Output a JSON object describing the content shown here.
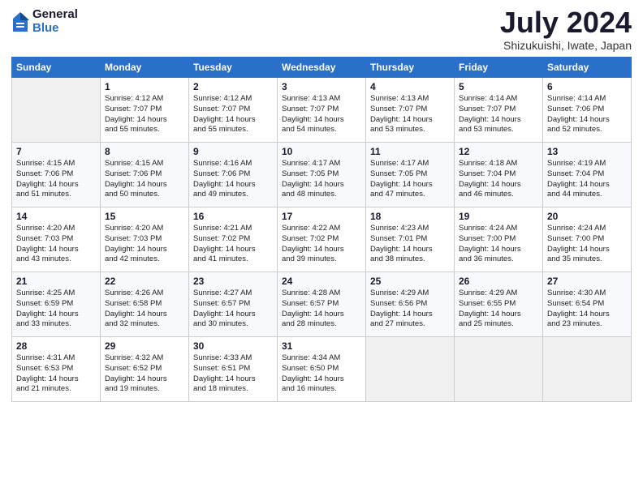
{
  "logo": {
    "general": "General",
    "blue": "Blue"
  },
  "title": "July 2024",
  "location": "Shizukuishi, Iwate, Japan",
  "headers": [
    "Sunday",
    "Monday",
    "Tuesday",
    "Wednesday",
    "Thursday",
    "Friday",
    "Saturday"
  ],
  "weeks": [
    [
      {
        "day": "",
        "info": ""
      },
      {
        "day": "1",
        "info": "Sunrise: 4:12 AM\nSunset: 7:07 PM\nDaylight: 14 hours\nand 55 minutes."
      },
      {
        "day": "2",
        "info": "Sunrise: 4:12 AM\nSunset: 7:07 PM\nDaylight: 14 hours\nand 55 minutes."
      },
      {
        "day": "3",
        "info": "Sunrise: 4:13 AM\nSunset: 7:07 PM\nDaylight: 14 hours\nand 54 minutes."
      },
      {
        "day": "4",
        "info": "Sunrise: 4:13 AM\nSunset: 7:07 PM\nDaylight: 14 hours\nand 53 minutes."
      },
      {
        "day": "5",
        "info": "Sunrise: 4:14 AM\nSunset: 7:07 PM\nDaylight: 14 hours\nand 53 minutes."
      },
      {
        "day": "6",
        "info": "Sunrise: 4:14 AM\nSunset: 7:06 PM\nDaylight: 14 hours\nand 52 minutes."
      }
    ],
    [
      {
        "day": "7",
        "info": "Sunrise: 4:15 AM\nSunset: 7:06 PM\nDaylight: 14 hours\nand 51 minutes."
      },
      {
        "day": "8",
        "info": "Sunrise: 4:15 AM\nSunset: 7:06 PM\nDaylight: 14 hours\nand 50 minutes."
      },
      {
        "day": "9",
        "info": "Sunrise: 4:16 AM\nSunset: 7:06 PM\nDaylight: 14 hours\nand 49 minutes."
      },
      {
        "day": "10",
        "info": "Sunrise: 4:17 AM\nSunset: 7:05 PM\nDaylight: 14 hours\nand 48 minutes."
      },
      {
        "day": "11",
        "info": "Sunrise: 4:17 AM\nSunset: 7:05 PM\nDaylight: 14 hours\nand 47 minutes."
      },
      {
        "day": "12",
        "info": "Sunrise: 4:18 AM\nSunset: 7:04 PM\nDaylight: 14 hours\nand 46 minutes."
      },
      {
        "day": "13",
        "info": "Sunrise: 4:19 AM\nSunset: 7:04 PM\nDaylight: 14 hours\nand 44 minutes."
      }
    ],
    [
      {
        "day": "14",
        "info": "Sunrise: 4:20 AM\nSunset: 7:03 PM\nDaylight: 14 hours\nand 43 minutes."
      },
      {
        "day": "15",
        "info": "Sunrise: 4:20 AM\nSunset: 7:03 PM\nDaylight: 14 hours\nand 42 minutes."
      },
      {
        "day": "16",
        "info": "Sunrise: 4:21 AM\nSunset: 7:02 PM\nDaylight: 14 hours\nand 41 minutes."
      },
      {
        "day": "17",
        "info": "Sunrise: 4:22 AM\nSunset: 7:02 PM\nDaylight: 14 hours\nand 39 minutes."
      },
      {
        "day": "18",
        "info": "Sunrise: 4:23 AM\nSunset: 7:01 PM\nDaylight: 14 hours\nand 38 minutes."
      },
      {
        "day": "19",
        "info": "Sunrise: 4:24 AM\nSunset: 7:00 PM\nDaylight: 14 hours\nand 36 minutes."
      },
      {
        "day": "20",
        "info": "Sunrise: 4:24 AM\nSunset: 7:00 PM\nDaylight: 14 hours\nand 35 minutes."
      }
    ],
    [
      {
        "day": "21",
        "info": "Sunrise: 4:25 AM\nSunset: 6:59 PM\nDaylight: 14 hours\nand 33 minutes."
      },
      {
        "day": "22",
        "info": "Sunrise: 4:26 AM\nSunset: 6:58 PM\nDaylight: 14 hours\nand 32 minutes."
      },
      {
        "day": "23",
        "info": "Sunrise: 4:27 AM\nSunset: 6:57 PM\nDaylight: 14 hours\nand 30 minutes."
      },
      {
        "day": "24",
        "info": "Sunrise: 4:28 AM\nSunset: 6:57 PM\nDaylight: 14 hours\nand 28 minutes."
      },
      {
        "day": "25",
        "info": "Sunrise: 4:29 AM\nSunset: 6:56 PM\nDaylight: 14 hours\nand 27 minutes."
      },
      {
        "day": "26",
        "info": "Sunrise: 4:29 AM\nSunset: 6:55 PM\nDaylight: 14 hours\nand 25 minutes."
      },
      {
        "day": "27",
        "info": "Sunrise: 4:30 AM\nSunset: 6:54 PM\nDaylight: 14 hours\nand 23 minutes."
      }
    ],
    [
      {
        "day": "28",
        "info": "Sunrise: 4:31 AM\nSunset: 6:53 PM\nDaylight: 14 hours\nand 21 minutes."
      },
      {
        "day": "29",
        "info": "Sunrise: 4:32 AM\nSunset: 6:52 PM\nDaylight: 14 hours\nand 19 minutes."
      },
      {
        "day": "30",
        "info": "Sunrise: 4:33 AM\nSunset: 6:51 PM\nDaylight: 14 hours\nand 18 minutes."
      },
      {
        "day": "31",
        "info": "Sunrise: 4:34 AM\nSunset: 6:50 PM\nDaylight: 14 hours\nand 16 minutes."
      },
      {
        "day": "",
        "info": ""
      },
      {
        "day": "",
        "info": ""
      },
      {
        "day": "",
        "info": ""
      }
    ]
  ]
}
